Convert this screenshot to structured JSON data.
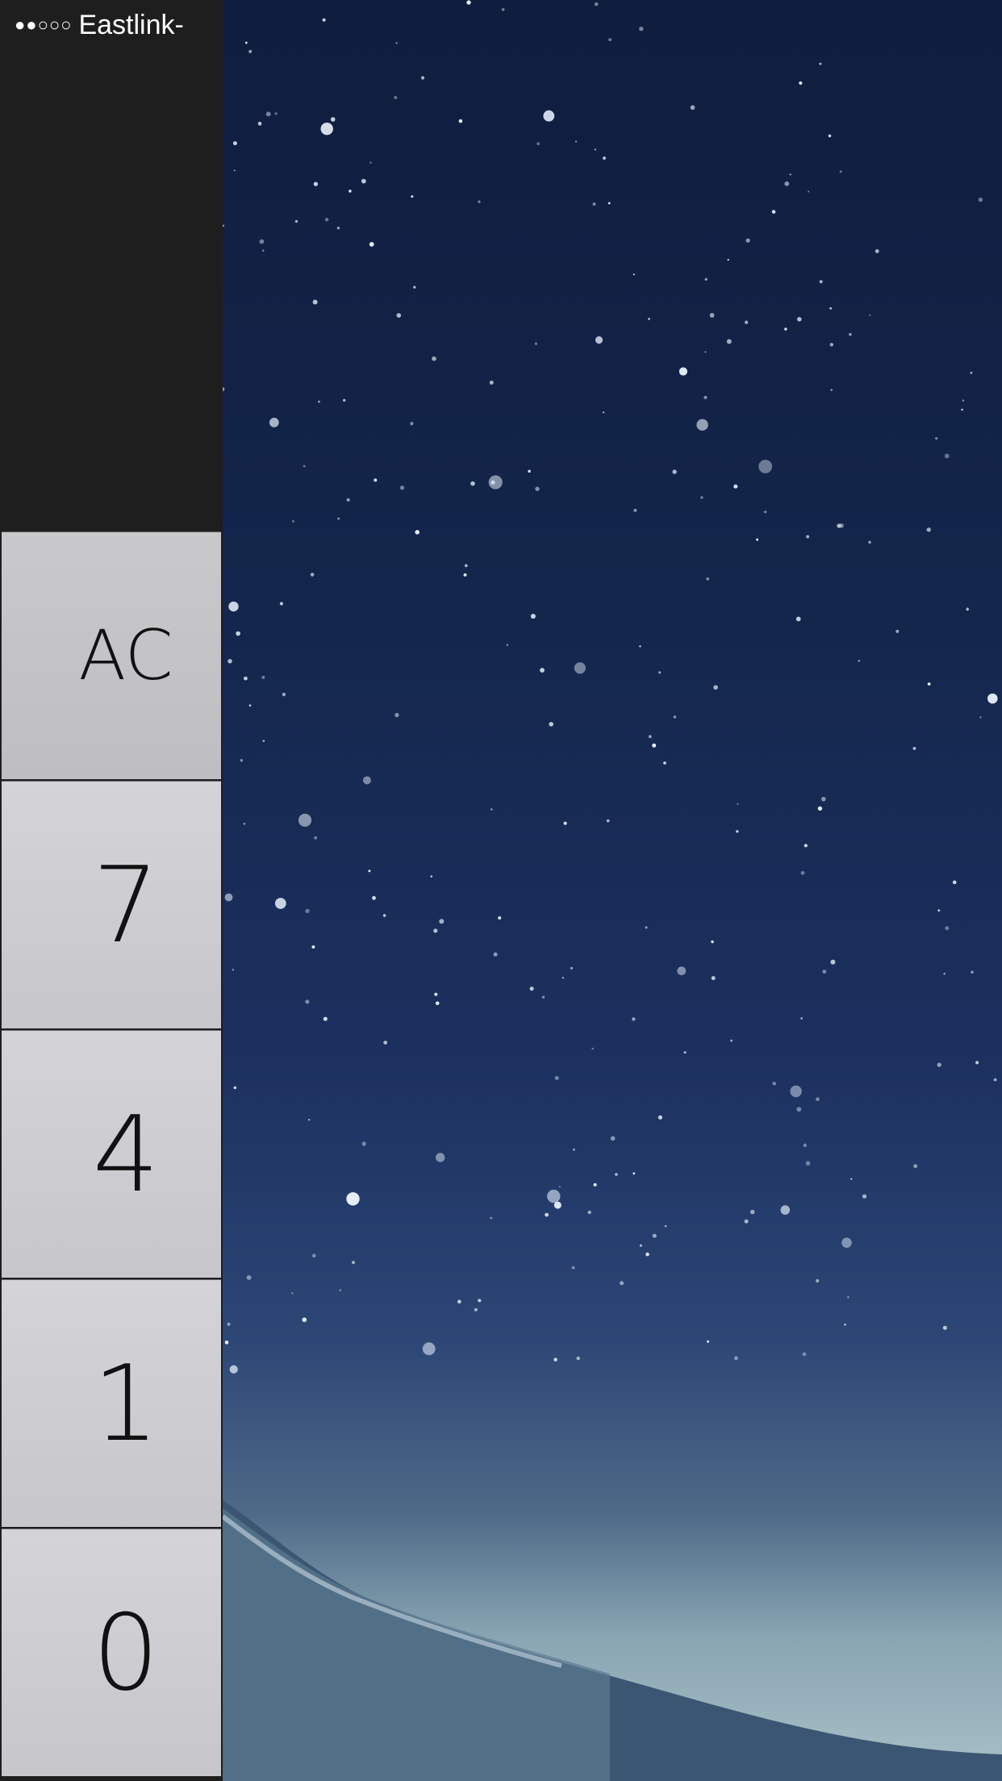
{
  "status_bar": {
    "signal": "●●○○○",
    "carrier": "Eastlink-"
  },
  "display": {
    "value": ""
  },
  "keypad": {
    "keys": [
      {
        "label": "AC"
      },
      {
        "label": "7"
      },
      {
        "label": "4"
      },
      {
        "label": "1"
      },
      {
        "label": "0"
      }
    ]
  },
  "wallpaper": {
    "subject": "starry night sky over snowy mountain"
  }
}
